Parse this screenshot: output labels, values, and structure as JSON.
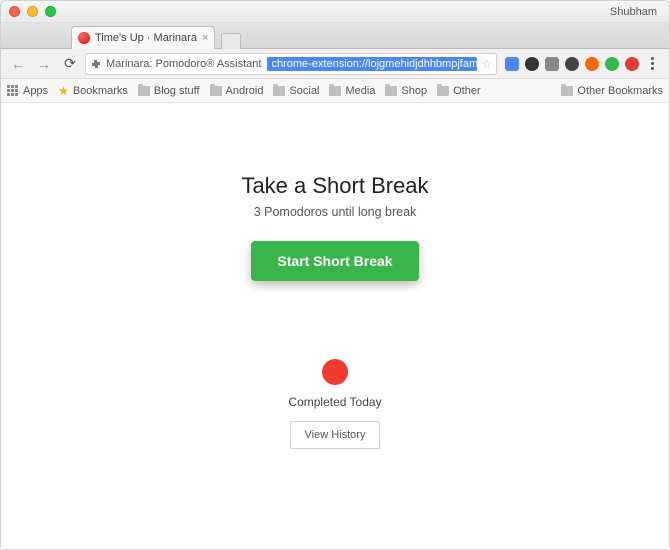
{
  "window": {
    "profile_name": "Shubham"
  },
  "tab": {
    "title": "Time's Up · Marinara"
  },
  "omnibox": {
    "site_title": "Marinara: Pomodoro® Assistant",
    "url_selected": "chrome-extension://lojgmehidjdhhbmpjfamhpkpodfcodef/expire/expire."
  },
  "bookmarks": {
    "apps": "Apps",
    "bookmarks": "Bookmarks",
    "blog": "Blog stuff",
    "android": "Android",
    "social": "Social",
    "media": "Media",
    "shop": "Shop",
    "other": "Other",
    "other_bookmarks": "Other Bookmarks"
  },
  "content": {
    "heading": "Take a Short Break",
    "subheading": "3 Pomodoros until long break",
    "start_button": "Start Short Break",
    "completed_label": "Completed Today",
    "history_button": "View History"
  }
}
